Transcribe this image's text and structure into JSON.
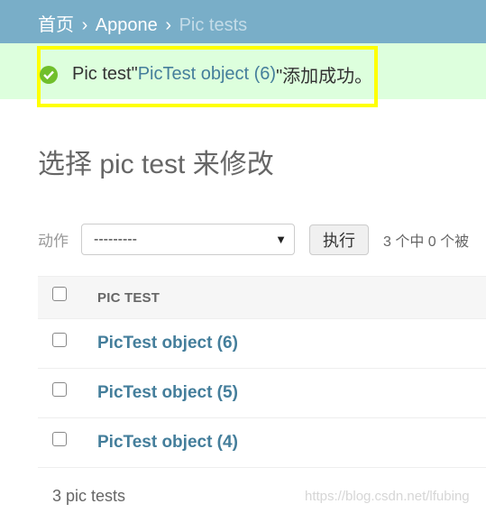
{
  "breadcrumbs": {
    "home": "首页",
    "app": "Appone",
    "current": "Pic tests",
    "separator": "›"
  },
  "message": {
    "prefix": "Pic test\"",
    "object_link": "PicTest object (6)",
    "suffix": "\"添加成功。",
    "icon": "success-check-icon"
  },
  "page_title": "选择 pic test 来修改",
  "actions": {
    "label": "动作",
    "select_value": "---------",
    "go_button": "执行",
    "counter": "3 个中 0 个被"
  },
  "table": {
    "header": "PIC TEST",
    "rows": [
      {
        "label": "PicTest object (6)"
      },
      {
        "label": "PicTest object (5)"
      },
      {
        "label": "PicTest object (4)"
      }
    ]
  },
  "paginator": "3 pic tests",
  "watermark": "https://blog.csdn.net/lfubing",
  "colors": {
    "header_bg": "#79aec8",
    "message_bg": "#dfd",
    "highlight_border": "#ffff00",
    "link": "#447e9b",
    "success": "#70bf2b"
  }
}
